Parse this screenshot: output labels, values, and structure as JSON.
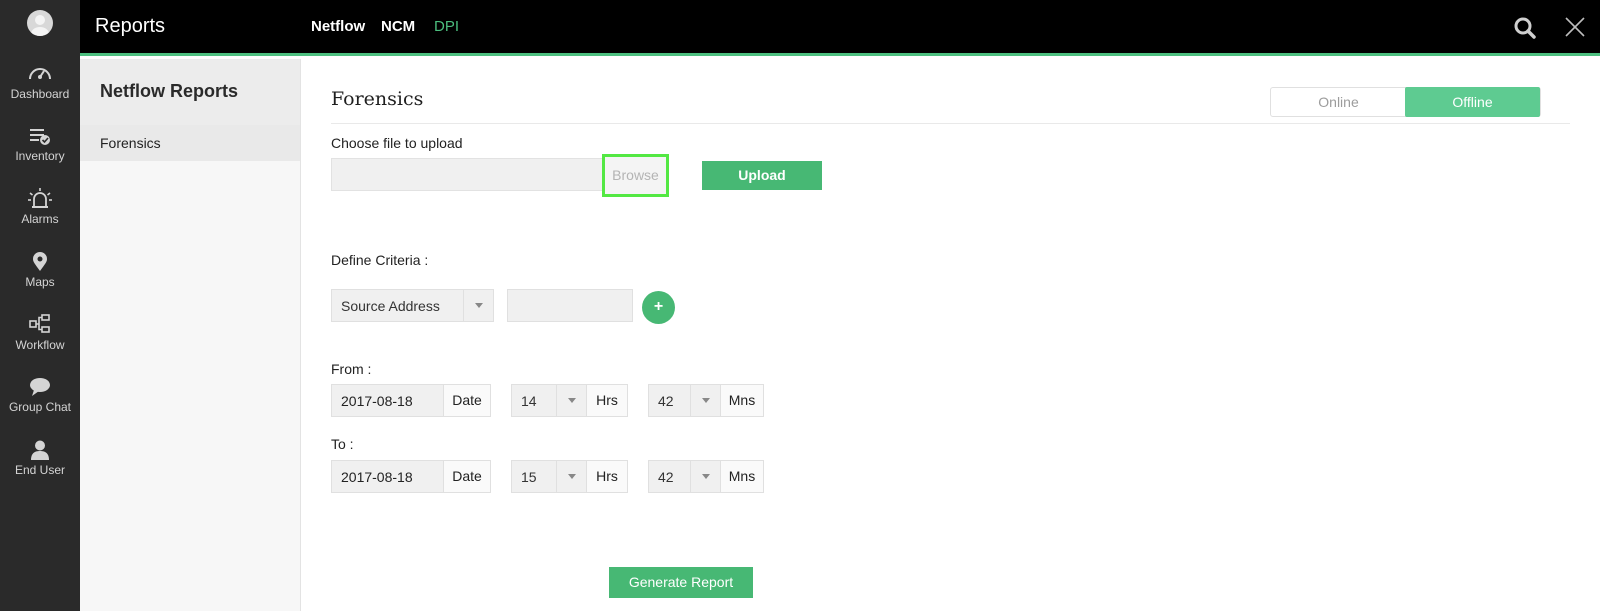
{
  "app": {
    "title": "Reports"
  },
  "rail": {
    "items": [
      {
        "label": "Dashboard",
        "icon": "gauge-icon"
      },
      {
        "label": "Inventory",
        "icon": "inventory-icon"
      },
      {
        "label": "Alarms",
        "icon": "alarm-icon"
      },
      {
        "label": "Maps",
        "icon": "map-pin-icon"
      },
      {
        "label": "Workflow",
        "icon": "workflow-icon"
      },
      {
        "label": "Group Chat",
        "icon": "chat-icon"
      },
      {
        "label": "End User",
        "icon": "user-icon"
      }
    ]
  },
  "topnav": {
    "tabs": [
      {
        "label": "Netflow"
      },
      {
        "label": "NCM"
      },
      {
        "label": "DPI",
        "active": true
      }
    ],
    "accent_color": "#4cbf7f"
  },
  "sidebar": {
    "title": "Netflow Reports",
    "items": [
      {
        "label": "Forensics"
      }
    ]
  },
  "main": {
    "title": "Forensics",
    "mode": {
      "online": "Online",
      "offline": "Offline",
      "selected": "Offline"
    },
    "upload": {
      "label": "Choose file to upload",
      "file_value": "",
      "browse_label": "Browse",
      "upload_label": "Upload"
    },
    "criteria": {
      "label": "Define Criteria :",
      "field": "Source Address",
      "value": "",
      "add_label": "+"
    },
    "from": {
      "label": "From :",
      "date": "2017-08-18",
      "date_suffix": "Date",
      "hours": "14",
      "hours_suffix": "Hrs",
      "minutes": "42",
      "minutes_suffix": "Mns"
    },
    "to": {
      "label": "To :",
      "date": "2017-08-18",
      "date_suffix": "Date",
      "hours": "15",
      "hours_suffix": "Hrs",
      "minutes": "42",
      "minutes_suffix": "Mns"
    },
    "generate_label": "Generate Report"
  }
}
